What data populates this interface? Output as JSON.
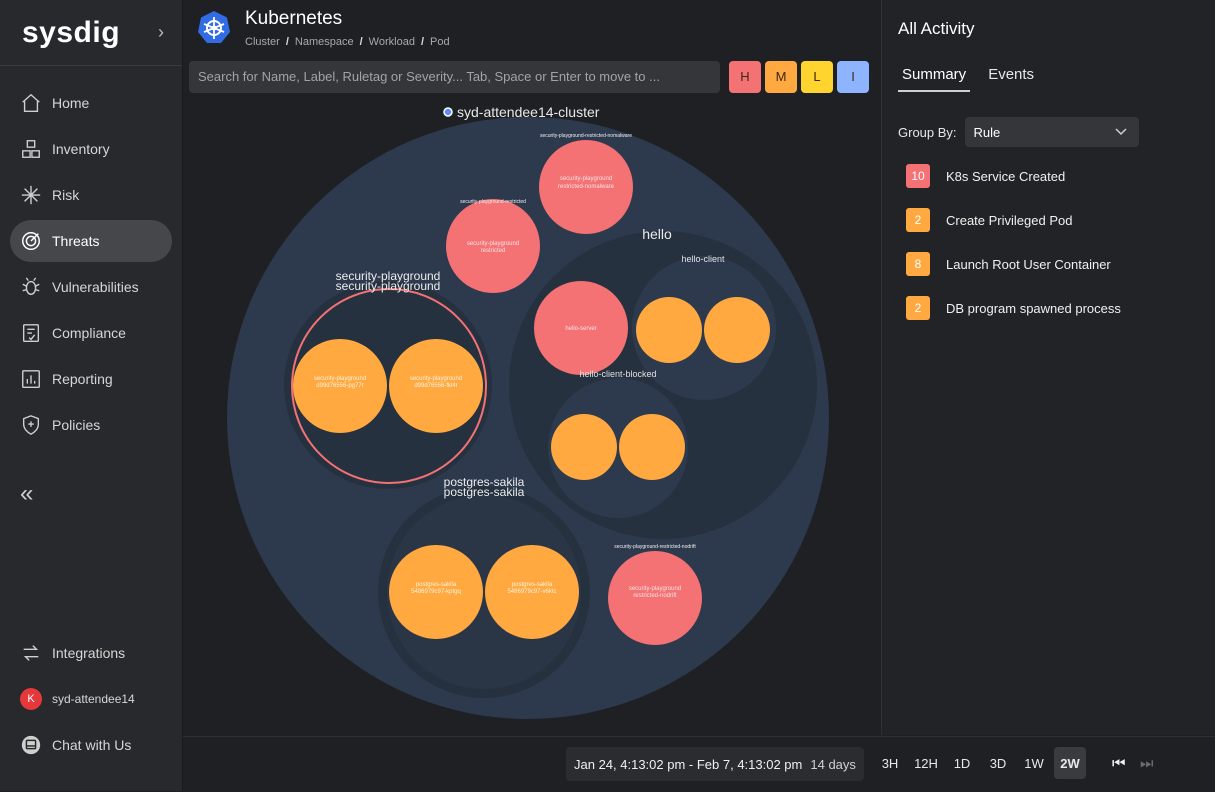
{
  "sidebar": {
    "logo": "sysdig",
    "items": [
      {
        "label": "Home"
      },
      {
        "label": "Inventory"
      },
      {
        "label": "Risk"
      },
      {
        "label": "Threats"
      },
      {
        "label": "Vulnerabilities"
      },
      {
        "label": "Compliance"
      },
      {
        "label": "Reporting"
      },
      {
        "label": "Policies"
      }
    ],
    "bottom": {
      "integrations": "Integrations",
      "user": "syd-attendee14",
      "user_initial": "K",
      "chat": "Chat with Us"
    }
  },
  "header": {
    "title": "Kubernetes",
    "breadcrumb": [
      "Cluster",
      "Namespace",
      "Workload",
      "Pod"
    ]
  },
  "search": {
    "placeholder": "Search for Name, Label, Ruletag or Severity... Tab, Space or Enter to move to ..."
  },
  "severity_filters": [
    "H",
    "M",
    "L",
    "I"
  ],
  "viz": {
    "cluster": "syd-attendee14-cluster",
    "ns_security_playground": "security-playground",
    "ns_security_playground_sub": "security-playground",
    "ns_hello": "hello",
    "ns_postgres": "postgres-sakila",
    "ns_postgres_sub": "postgres-sakila",
    "wl_hello_client": "hello-client",
    "wl_hello_client_blocked": "hello-client-blocked",
    "restricted_nomalware_label": "security-playground-restricted-nomalware",
    "restricted_nomalware_text1": "security-playground",
    "restricted_nomalware_text2": "restricted-nomalware",
    "restricted_label": "security-playground-restricted",
    "restricted_text1": "security-playground",
    "restricted_text2": "restricted",
    "hello_server": "hello-server",
    "sp_pod1_text1": "security-playground",
    "sp_pod1_text2": "d99d76556-pg77r",
    "sp_pod2_text1": "security-playground",
    "sp_pod2_text2": "d99d76556-fkl4r",
    "pg_pod1_text1": "postgres-sakila",
    "pg_pod1_text2": "5486979c97-kptgq",
    "pg_pod2_text1": "postgres-sakila",
    "pg_pod2_text2": "5486979c97-v6ktc",
    "nodrift_label": "security-playground-restricted-nodrift",
    "nodrift_text1": "security-playground",
    "nodrift_text2": "restricted-nodrift"
  },
  "activity": {
    "title": "All Activity",
    "tabs": [
      "Summary",
      "Events"
    ],
    "group_by_label": "Group By:",
    "group_by_value": "Rule",
    "rules": [
      {
        "count": "10",
        "label": "K8s Service Created",
        "severity": "high"
      },
      {
        "count": "2",
        "label": "Create Privileged Pod",
        "severity": "medium"
      },
      {
        "count": "8",
        "label": "Launch Root User Container",
        "severity": "medium"
      },
      {
        "count": "2",
        "label": "DB program spawned process",
        "severity": "medium"
      }
    ]
  },
  "footer": {
    "range": "Jan 24, 4:13:02 pm - Feb 7, 4:13:02 pm",
    "days": "14 days",
    "time_buttons": [
      "3H",
      "12H",
      "1D",
      "3D",
      "1W",
      "2W"
    ],
    "active_time": "2W"
  },
  "colors": {
    "high": "#f47174",
    "medium": "#ffa940",
    "low": "#ffd42f",
    "info": "#8fb4ff",
    "cluster_fill": "#2d3a4e",
    "namespace_fill": "#26313f"
  }
}
